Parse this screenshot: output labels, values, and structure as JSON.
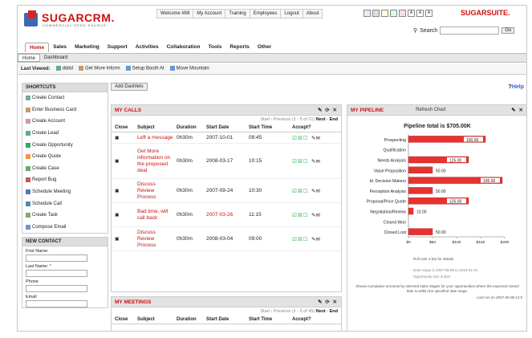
{
  "brand": {
    "name": "SUGARCRM.",
    "tagline": "COMMERCIAL OPEN SOURCE",
    "suite": "SUGARSUITE."
  },
  "topnav": [
    "Welcome Will",
    "My Account",
    "Training",
    "Employees",
    "Logout",
    "About"
  ],
  "search": {
    "label": "Search",
    "go": "Go"
  },
  "tabs": [
    "Home",
    "Sales",
    "Marketing",
    "Support",
    "Activities",
    "Collaboration",
    "Tools",
    "Reports",
    "Other"
  ],
  "subtabs": [
    "Home",
    "Dashboard"
  ],
  "last_viewed": {
    "label": "Last Viewed:",
    "items": [
      "dddd",
      "Get More Inform",
      "Setup Booth At",
      "Move Mountain"
    ]
  },
  "shortcuts": {
    "title": "SHORTCUTS",
    "items": [
      "Create Contact",
      "Enter Business Card",
      "Create Account",
      "Create Lead",
      "Create Opportunity",
      "Create Quote",
      "Create Case",
      "Report Bug",
      "Schedule Meeting",
      "Schedule Call",
      "Create Task",
      "Compose Email"
    ]
  },
  "new_contact": {
    "title": "NEW CONTACT",
    "fields": [
      {
        "label": "First Name:"
      },
      {
        "label": "Last Name:",
        "required": "*"
      },
      {
        "label": "Phone"
      },
      {
        "label": "Email"
      }
    ]
  },
  "add_dashlets": "Add Dashlets",
  "help": {
    "q": "?",
    "text": "Help"
  },
  "calls": {
    "title": "MY CALLS",
    "controls": "✎ ⟳ ✕",
    "pager": {
      "start": "Start",
      "prev": "Previous",
      "range": "(1 - 5 of 21)",
      "next": "Next",
      "end": "End"
    },
    "headers": [
      "Close",
      "Subject",
      "Duration",
      "Start Date",
      "Start Time",
      "Accept?"
    ],
    "rows": [
      {
        "subject": "Left a message",
        "duration": "0h30m",
        "date": "2007-10-01",
        "time": "09:45",
        "overdue": false
      },
      {
        "subject": "Get More information on the proposed deal",
        "duration": "0h30m",
        "date": "2008-03-17",
        "time": "10:15",
        "overdue": false
      },
      {
        "subject": "Discuss Review Process",
        "duration": "0h30m",
        "date": "2007-09-24",
        "time": "10:30",
        "overdue": false
      },
      {
        "subject": "Bad time, will call back",
        "duration": "0h30m",
        "date": "2007-03-26",
        "time": "11:15",
        "overdue": true
      },
      {
        "subject": "Discuss Review Process",
        "duration": "0h30m",
        "date": "2008-03-04",
        "time": "09:00",
        "overdue": false
      }
    ]
  },
  "meetings": {
    "title": "MY MEETINGS",
    "controls": "✎ ⟳ ✕",
    "pager": {
      "start": "Start",
      "prev": "Previous",
      "range": "(1 - 5 of 45)",
      "next": "Next",
      "end": "End"
    },
    "headers": [
      "Close",
      "Subject",
      "Duration",
      "Start Date",
      "Start Time",
      "Accept?"
    ]
  },
  "pipeline": {
    "title": "MY PIPELINE",
    "refresh": "Refresh Chart",
    "controls": "✎ ✕",
    "footnote1": "Roll over a bar for details.",
    "footnote2": "Date range is 2007-05-08 to 2010-01-01",
    "footnote3": "Opportunity size in $1K",
    "desc": "Shows cumulative amounts by selected sales stages for your opportunities where the expected closed date is within the specified date range.",
    "rerun": "Last run on 2007-05-08 12:5"
  },
  "chart_data": {
    "type": "bar",
    "orientation": "horizontal",
    "title": "Pipeline total is $705.00K",
    "categories": [
      "Prospecting",
      "Qualification",
      "Needs Analysis",
      "Value Proposition",
      "Id. Decision Makers",
      "Perception Analysis",
      "Proposal/Price Quote",
      "Negotiation/Review",
      "Closed Won",
      "Closed Lost"
    ],
    "values": [
      160,
      0,
      125,
      50,
      195,
      50,
      125,
      10,
      0,
      50
    ],
    "data_labels": [
      "160.00",
      "",
      "125.00",
      "50.00",
      "195.00",
      "50.00",
      "125.00",
      "10.00",
      "",
      "50.00"
    ],
    "xticks": [
      "$0",
      "$50",
      "$100",
      "$150",
      "$200"
    ],
    "xlim": [
      0,
      200
    ],
    "color": "#e8322e"
  },
  "colors": {
    "accent": "#c11",
    "bar": "#e8322e"
  }
}
